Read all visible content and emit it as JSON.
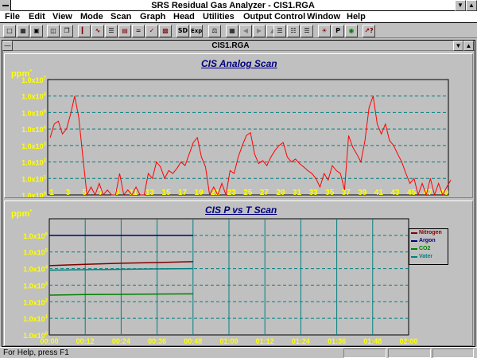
{
  "window": {
    "title": "SRS Residual Gas Analyzer - CIS1.RGA",
    "minimize_icon": "down-triangle-icon",
    "maximize_icon": "up-triangle-icon"
  },
  "menu": [
    "File",
    "Edit",
    "View",
    "Mode",
    "Scan",
    "Graph",
    "Head",
    "Utilities",
    "Output Control",
    "Window",
    "Help"
  ],
  "toolbar": {
    "buttons": [
      "new-file-icon",
      "open-folder-icon",
      "save-disk-icon",
      "print-icon",
      "copy-icon",
      "bar-graph-icon",
      "analog-graph-icon",
      "table-icon",
      "histogram-icon",
      "pvt-icon",
      "leak-icon",
      "pdf-icon",
      "sd-icon",
      "exp-icon",
      "balance-icon",
      "calc-icon",
      "arrow-left-icon",
      "arrow-right-icon",
      "arrow-up-icon",
      "list-icon",
      "list2-icon",
      "list3-icon",
      "filament-icon",
      "p-icon",
      "multiplier-icon",
      "help-cursor-icon"
    ],
    "sd_label": "SD",
    "exp_label": "Exp"
  },
  "child_window": {
    "title": "CIS1.RGA"
  },
  "status": {
    "text": "For Help, press F1"
  },
  "chart_data": [
    {
      "type": "line",
      "title": "CIS Analog Scan",
      "ylabel": "ppm*",
      "yscale": "log",
      "y_tick_labels": [
        "1.0x10^0",
        "1.0x10^1",
        "1.0x10^2",
        "1.0x10^3",
        "1.0x10^4",
        "1.0x10^5",
        "1.0x10^6",
        "1.0x10^7"
      ],
      "xlim": [
        1,
        50
      ],
      "x_tick_labels": [
        "1",
        "3",
        "5",
        "7",
        "9",
        "11",
        "13",
        "15",
        "17",
        "19",
        "21",
        "23",
        "25",
        "27",
        "29",
        "31",
        "33",
        "35",
        "37",
        "39",
        "41",
        "43",
        "45",
        "47",
        "49"
      ],
      "grid": true,
      "colors": {
        "plot_bg": "#c0c0c0",
        "grid": "#008080",
        "axis_text": "#ffff00",
        "line": "#ff0000"
      },
      "series": [
        {
          "x": [
            1,
            1.5,
            2,
            2.5,
            3,
            3.5,
            4,
            4.5,
            5,
            5.5,
            6,
            6.5,
            7,
            7.5,
            8,
            8.5,
            9,
            9.5,
            10,
            10.5,
            11,
            11.5,
            12,
            12.5,
            13,
            13.5,
            14,
            14.5,
            15,
            15.5,
            16,
            16.5,
            17,
            17.5,
            18,
            18.5,
            19,
            19.5,
            20,
            20.5,
            21,
            21.5,
            22,
            22.5,
            23,
            23.5,
            24,
            24.5,
            25,
            25.5,
            26,
            26.5,
            27,
            27.5,
            28,
            28.5,
            29,
            29.5,
            30,
            30.5,
            31,
            31.5,
            32,
            32.5,
            33,
            33.5,
            34,
            34.5,
            35,
            35.5,
            36,
            36.5,
            37,
            37.5,
            38,
            38.5,
            39,
            39.5,
            40,
            40.5,
            41,
            41.5,
            42,
            42.5,
            43,
            43.5,
            44,
            44.5,
            45,
            45.5,
            46,
            46.5,
            47,
            47.5,
            48,
            48.5,
            49,
            49.5,
            50
          ],
          "y": [
            3000,
            20000,
            30000,
            5000,
            10000,
            80000,
            1000000,
            50000,
            200,
            1,
            3,
            1,
            5,
            1,
            2,
            1,
            1,
            20,
            1,
            2,
            1,
            3,
            1,
            1,
            20,
            10,
            100,
            50,
            10,
            30,
            20,
            40,
            100,
            60,
            300,
            1500,
            3000,
            200,
            50,
            1,
            3,
            1,
            5,
            1,
            30,
            20,
            200,
            1000,
            4000,
            6000,
            300,
            80,
            120,
            60,
            200,
            500,
            1000,
            1500,
            200,
            100,
            150,
            80,
            50,
            30,
            20,
            10,
            3,
            20,
            8,
            60,
            30,
            20,
            2,
            4000,
            800,
            300,
            100,
            2000,
            200000,
            1000000,
            20000,
            5000,
            20000,
            2000,
            1000,
            300,
            100,
            20,
            5,
            10,
            1,
            5,
            1,
            10,
            1,
            5,
            1,
            3,
            8
          ]
        }
      ]
    },
    {
      "type": "line",
      "title": "CIS P vs T Scan",
      "ylabel": "ppm*",
      "yscale": "log",
      "y_tick_labels": [
        "1.0x10^0",
        "1.0x10^1",
        "1.0x10^2",
        "1.0x10^3",
        "1.0x10^4",
        "1.0x10^5",
        "1.0x10^6"
      ],
      "x_tick_labels": [
        "00:00",
        "00:12",
        "00:24",
        "00:36",
        "00:48",
        "01:00",
        "01:12",
        "01:24",
        "01:36",
        "01:48",
        "02:00"
      ],
      "xlim_minutes": [
        0,
        120
      ],
      "grid": true,
      "legend_position": "right",
      "colors": {
        "plot_bg": "#c0c0c0",
        "grid": "#008080",
        "axis_text": "#ffff00"
      },
      "series": [
        {
          "name": "Nitrogen",
          "color": "#800000",
          "x": [
            0,
            12,
            24,
            36,
            48
          ],
          "y": [
            15000,
            18000,
            21000,
            23000,
            26000
          ]
        },
        {
          "name": "Argon",
          "color": "#000080",
          "x": [
            0,
            12,
            24,
            36,
            48
          ],
          "y": [
            1000000,
            1000000,
            1000000,
            1000000,
            1000000
          ]
        },
        {
          "name": "CO2",
          "color": "#008000",
          "x": [
            0,
            12,
            24,
            36,
            48
          ],
          "y": [
            250,
            270,
            280,
            290,
            300
          ]
        },
        {
          "name": "Vater",
          "color": "#008080",
          "x": [
            0,
            12,
            24,
            36,
            48
          ],
          "y": [
            8000,
            8500,
            9000,
            9500,
            10000
          ]
        }
      ]
    }
  ]
}
